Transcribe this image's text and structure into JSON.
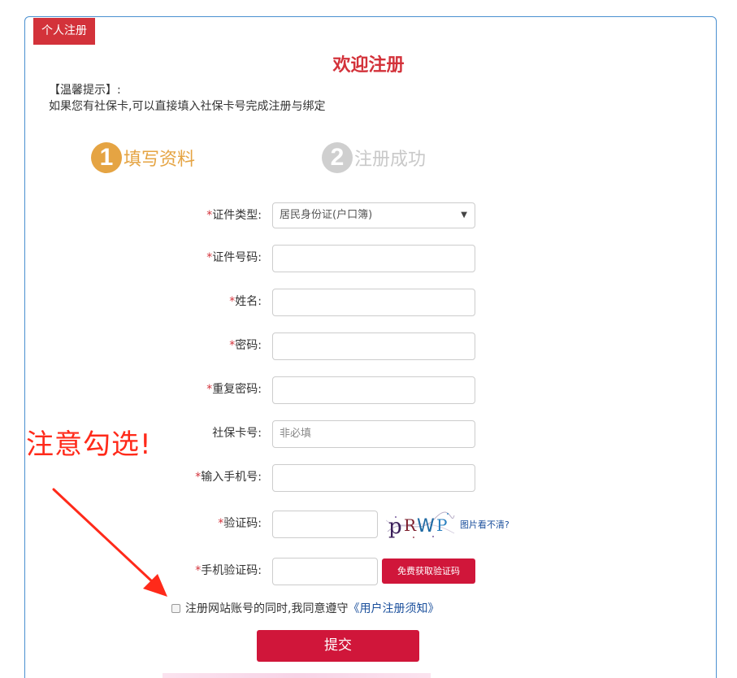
{
  "header": {
    "tag": "个人注册",
    "welcome": "欢迎注册",
    "tips_title": "【温馨提示】:",
    "tips_body": "如果您有社保卡,可以直接填入社保卡号完成注册与绑定"
  },
  "steps": [
    {
      "num": "1",
      "label": "填写资料",
      "color": "#e5a443",
      "active": true
    },
    {
      "num": "2",
      "label": "注册成功",
      "color": "#cfcfcf",
      "active": false
    }
  ],
  "form": {
    "id_type": {
      "required": "*",
      "label": "证件类型:",
      "value": "居民身份证(户口簿)"
    },
    "id_number": {
      "required": "*",
      "label": "证件号码:",
      "value": ""
    },
    "name": {
      "required": "*",
      "label": "姓名:",
      "value": ""
    },
    "password": {
      "required": "*",
      "label": "密码:",
      "value": ""
    },
    "confirm_password": {
      "required": "*",
      "label": "重复密码:",
      "value": ""
    },
    "social_card": {
      "required": "",
      "label": "社保卡号:",
      "placeholder": "非必填"
    },
    "phone": {
      "required": "*",
      "label": "输入手机号:",
      "value": ""
    },
    "captcha": {
      "required": "*",
      "label": "验证码:",
      "value": "",
      "image_text": "pRWP",
      "refresh_link": "图片看不清?"
    },
    "sms_code": {
      "required": "*",
      "label": "手机验证码:",
      "value": "",
      "button": "免费获取验证码"
    }
  },
  "agreement": {
    "text": "注册网站账号的同时,我同意遵守",
    "terms_link": "《用户注册须知》",
    "checked": false
  },
  "submit_label": "提交",
  "annotation": {
    "text": "注意勾选!",
    "color": "#ff2a1a"
  },
  "colors": {
    "brand_red": "#d3323a",
    "button_red": "#d0163a",
    "step_orange": "#e5a443",
    "link_blue": "#1a4f9c",
    "panel_border": "#4a90d0"
  }
}
